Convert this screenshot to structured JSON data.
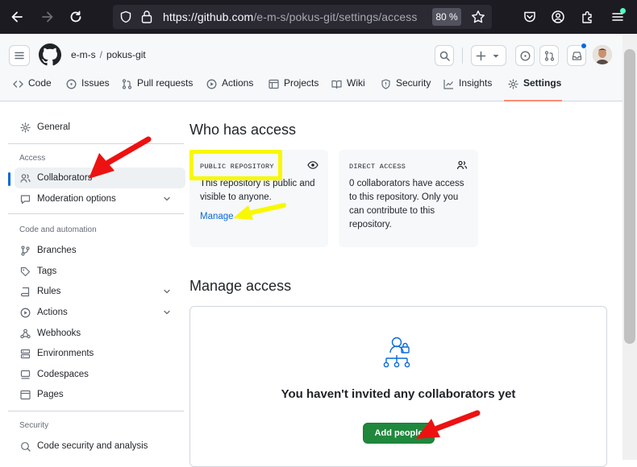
{
  "browser": {
    "url_host": "https://github.com",
    "url_path": "/e-m-s/pokus-git/settings/access",
    "zoom": "80 %"
  },
  "header": {
    "owner": "e-m-s",
    "separator": "/",
    "repo": "pokus-git"
  },
  "repo_tabs": [
    {
      "label": "Code",
      "icon": "code-icon"
    },
    {
      "label": "Issues",
      "icon": "issue-icon"
    },
    {
      "label": "Pull requests",
      "icon": "pull-request-icon"
    },
    {
      "label": "Actions",
      "icon": "play-icon"
    },
    {
      "label": "Projects",
      "icon": "table-icon"
    },
    {
      "label": "Wiki",
      "icon": "book-icon"
    },
    {
      "label": "Security",
      "icon": "shield-icon"
    },
    {
      "label": "Insights",
      "icon": "graph-icon"
    },
    {
      "label": "Settings",
      "icon": "gear-icon",
      "active": true
    }
  ],
  "sidebar": {
    "general": "General",
    "access_heading": "Access",
    "collaborators": "Collaborators",
    "moderation": "Moderation options",
    "code_heading": "Code and automation",
    "branches": "Branches",
    "tags": "Tags",
    "rules": "Rules",
    "actions": "Actions",
    "webhooks": "Webhooks",
    "environments": "Environments",
    "codespaces": "Codespaces",
    "pages": "Pages",
    "security_heading": "Security",
    "code_security": "Code security and analysis"
  },
  "main": {
    "who_title": "Who has access",
    "public_card": {
      "label": "PUBLIC REPOSITORY",
      "text": "This repository is public and visible to anyone.",
      "link": "Manage"
    },
    "direct_card": {
      "label": "DIRECT ACCESS",
      "text": "0 collaborators have access to this repository. Only you can contribute to this repository."
    },
    "manage_title": "Manage access",
    "empty_title": "You haven't invited any collaborators yet",
    "add_button": "Add people"
  },
  "colors": {
    "accent_link": "#0969da",
    "primary_button": "#1f883d",
    "tab_underline": "#fd8c73",
    "annotation_red": "#ee1111",
    "annotation_yellow": "#f8f800"
  }
}
